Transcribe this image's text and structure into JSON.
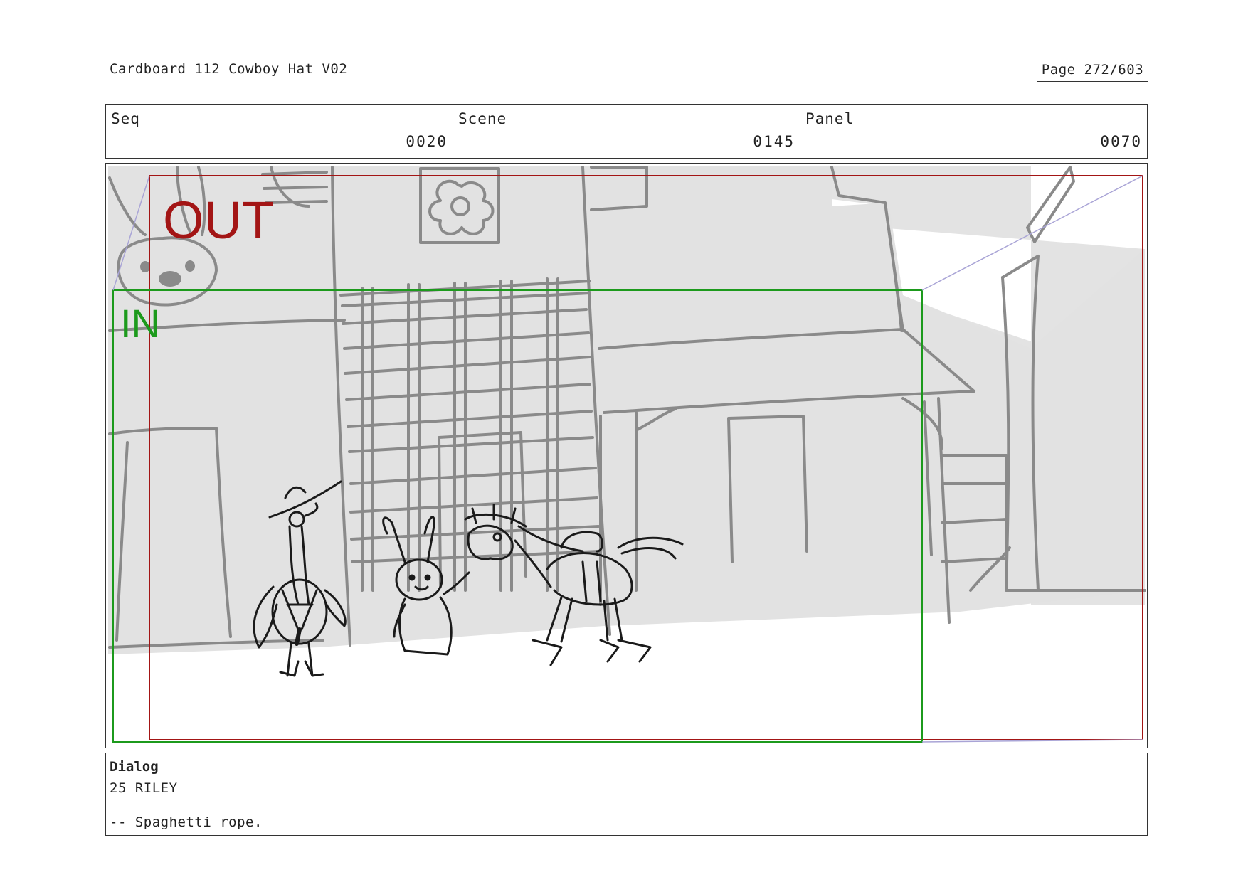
{
  "header": {
    "title": "Cardboard 112 Cowboy Hat V02",
    "page": "Page 272/603"
  },
  "info": {
    "seq_label": "Seq",
    "seq_value": "0020",
    "scene_label": "Scene",
    "scene_value": "0145",
    "panel_label": "Panel",
    "panel_value": "0070"
  },
  "frame": {
    "out_label": "OUT",
    "in_label": "IN",
    "colors": {
      "out": "#a31515",
      "in": "#1c9a1c",
      "background_sketch": "#8a8a8a",
      "sky": "#e3e3e3"
    }
  },
  "dialog": {
    "heading": "Dialog",
    "character": "25 RILEY",
    "line": "-- Spaghetti rope."
  }
}
